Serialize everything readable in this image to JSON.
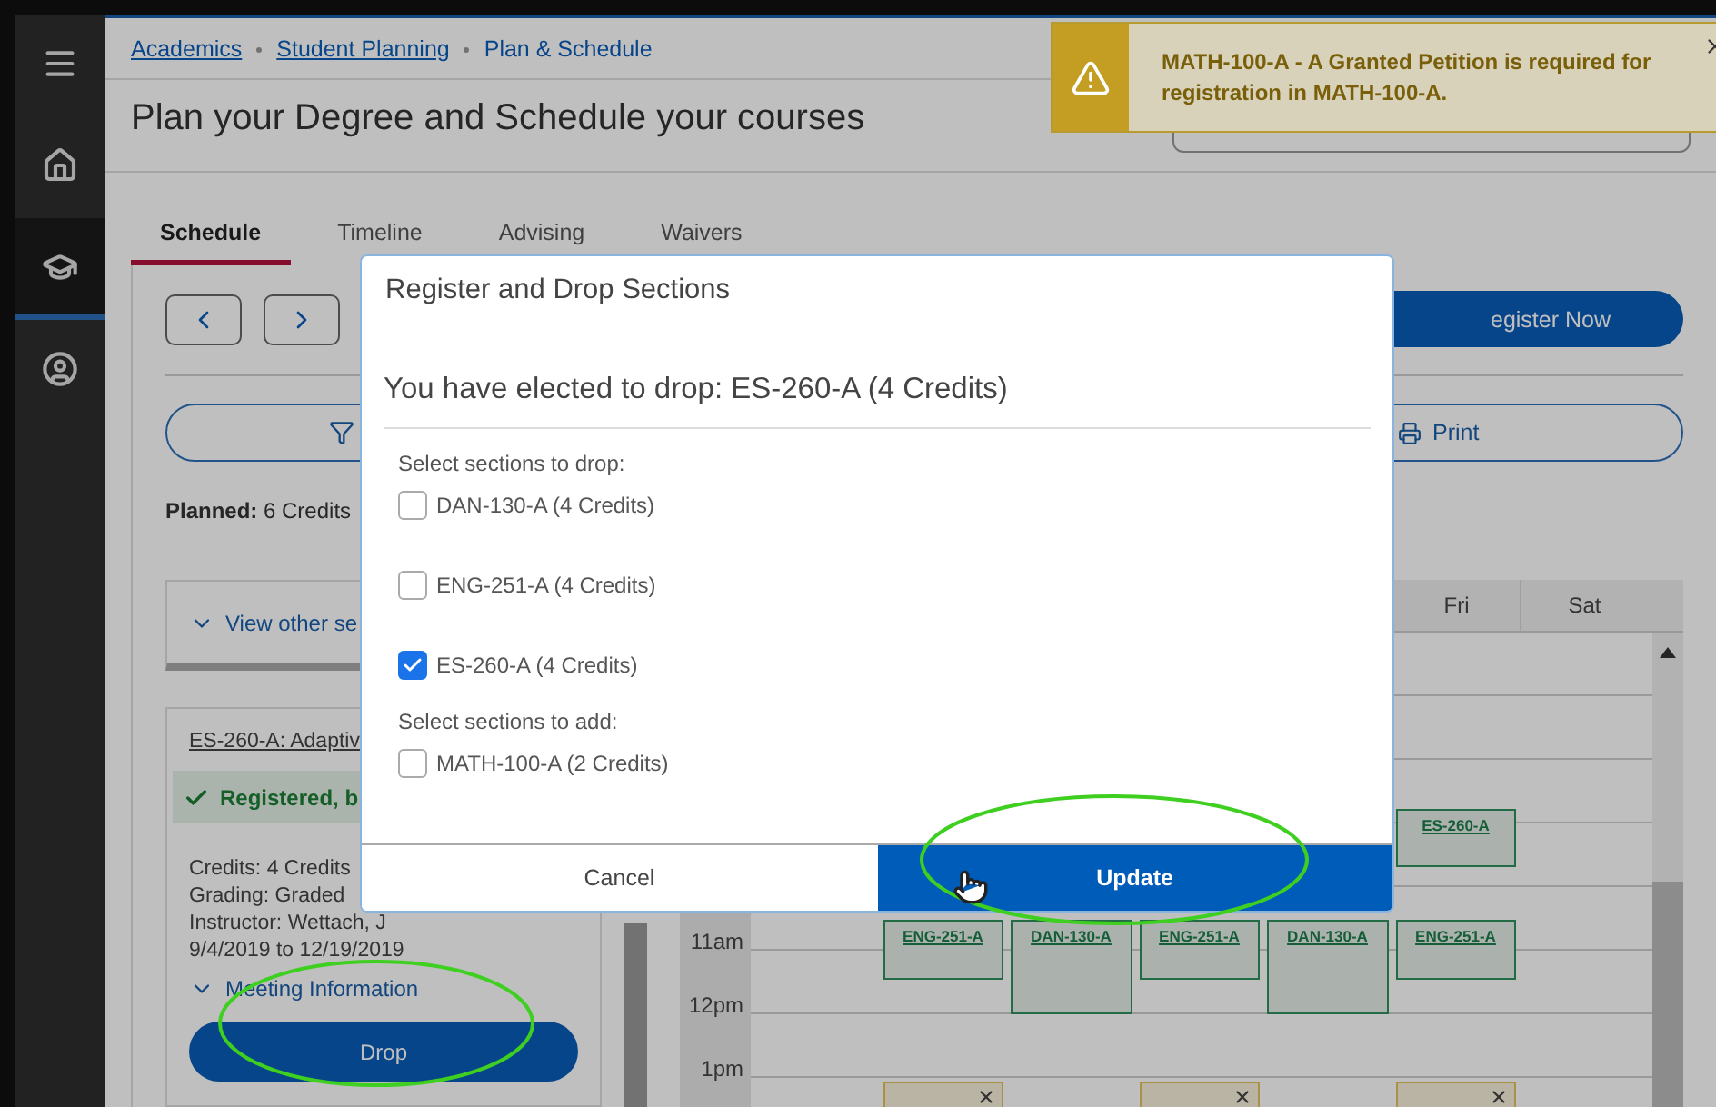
{
  "sidebar": {
    "items": [
      {
        "selected": false
      },
      {
        "selected": false
      },
      {
        "selected": true
      },
      {
        "selected": false
      }
    ]
  },
  "breadcrumbs": [
    {
      "label": "Academics",
      "kind": "link"
    },
    {
      "label": "Student Planning",
      "kind": "link"
    },
    {
      "label": "Plan & Schedule",
      "kind": "current"
    }
  ],
  "page_title": "Plan your Degree and Schedule your courses",
  "toast": {
    "message": "MATH-100-A - A Granted Petition is required for registration in MATH-100-A."
  },
  "tabs": [
    {
      "label": "Schedule",
      "selected": true
    },
    {
      "label": "Timeline",
      "selected": false
    },
    {
      "label": "Advising",
      "selected": false
    },
    {
      "label": "Waivers",
      "selected": false
    }
  ],
  "register_button": "egister Now",
  "print_button": "Print",
  "planned": "**Planned:** 6 Credits",
  "view_other_link": "View other se",
  "course_card": {
    "title": "ES-260-A: Adaptiv",
    "status": "Registered, b",
    "details": [
      "Credits: 4 Credits",
      "Grading: Graded",
      "Instructor: Wettach, J",
      "9/4/2019 to 12/19/2019"
    ],
    "meeting_link": "Meeting Information",
    "drop_button": "Drop"
  },
  "calendar": {
    "headers": [
      "Fri",
      "Sat"
    ],
    "times": [
      "11am",
      "12pm",
      "1pm"
    ],
    "events": [
      {
        "kind": "registered",
        "label": "ES-260-A"
      },
      {
        "kind": "registered",
        "label": "ENG-251-A"
      },
      {
        "kind": "registered",
        "label": "DAN-130-A"
      },
      {
        "kind": "registered",
        "label": "ENG-251-A"
      },
      {
        "kind": "registered",
        "label": "DAN-130-A"
      },
      {
        "kind": "registered",
        "label": "ENG-251-A"
      },
      {
        "kind": "planned"
      },
      {
        "kind": "planned"
      },
      {
        "kind": "planned"
      }
    ]
  },
  "modal": {
    "title": "Register and Drop Sections",
    "summary": "You have elected to drop: ES-260-A (4 Credits)",
    "groups": [
      {
        "heading": "Select sections to drop:",
        "options": [
          {
            "label": "DAN-130-A (4 Credits)",
            "checked": false
          },
          {
            "label": "ENG-251-A (4 Credits)",
            "checked": false
          },
          {
            "label": "ES-260-A (4 Credits)",
            "checked": true
          }
        ]
      },
      {
        "heading": "Select sections to add:",
        "options": [
          {
            "label": "MATH-100-A (2 Credits)",
            "checked": false
          }
        ]
      }
    ],
    "cancel_button": "Cancel",
    "update_button": "Update"
  }
}
